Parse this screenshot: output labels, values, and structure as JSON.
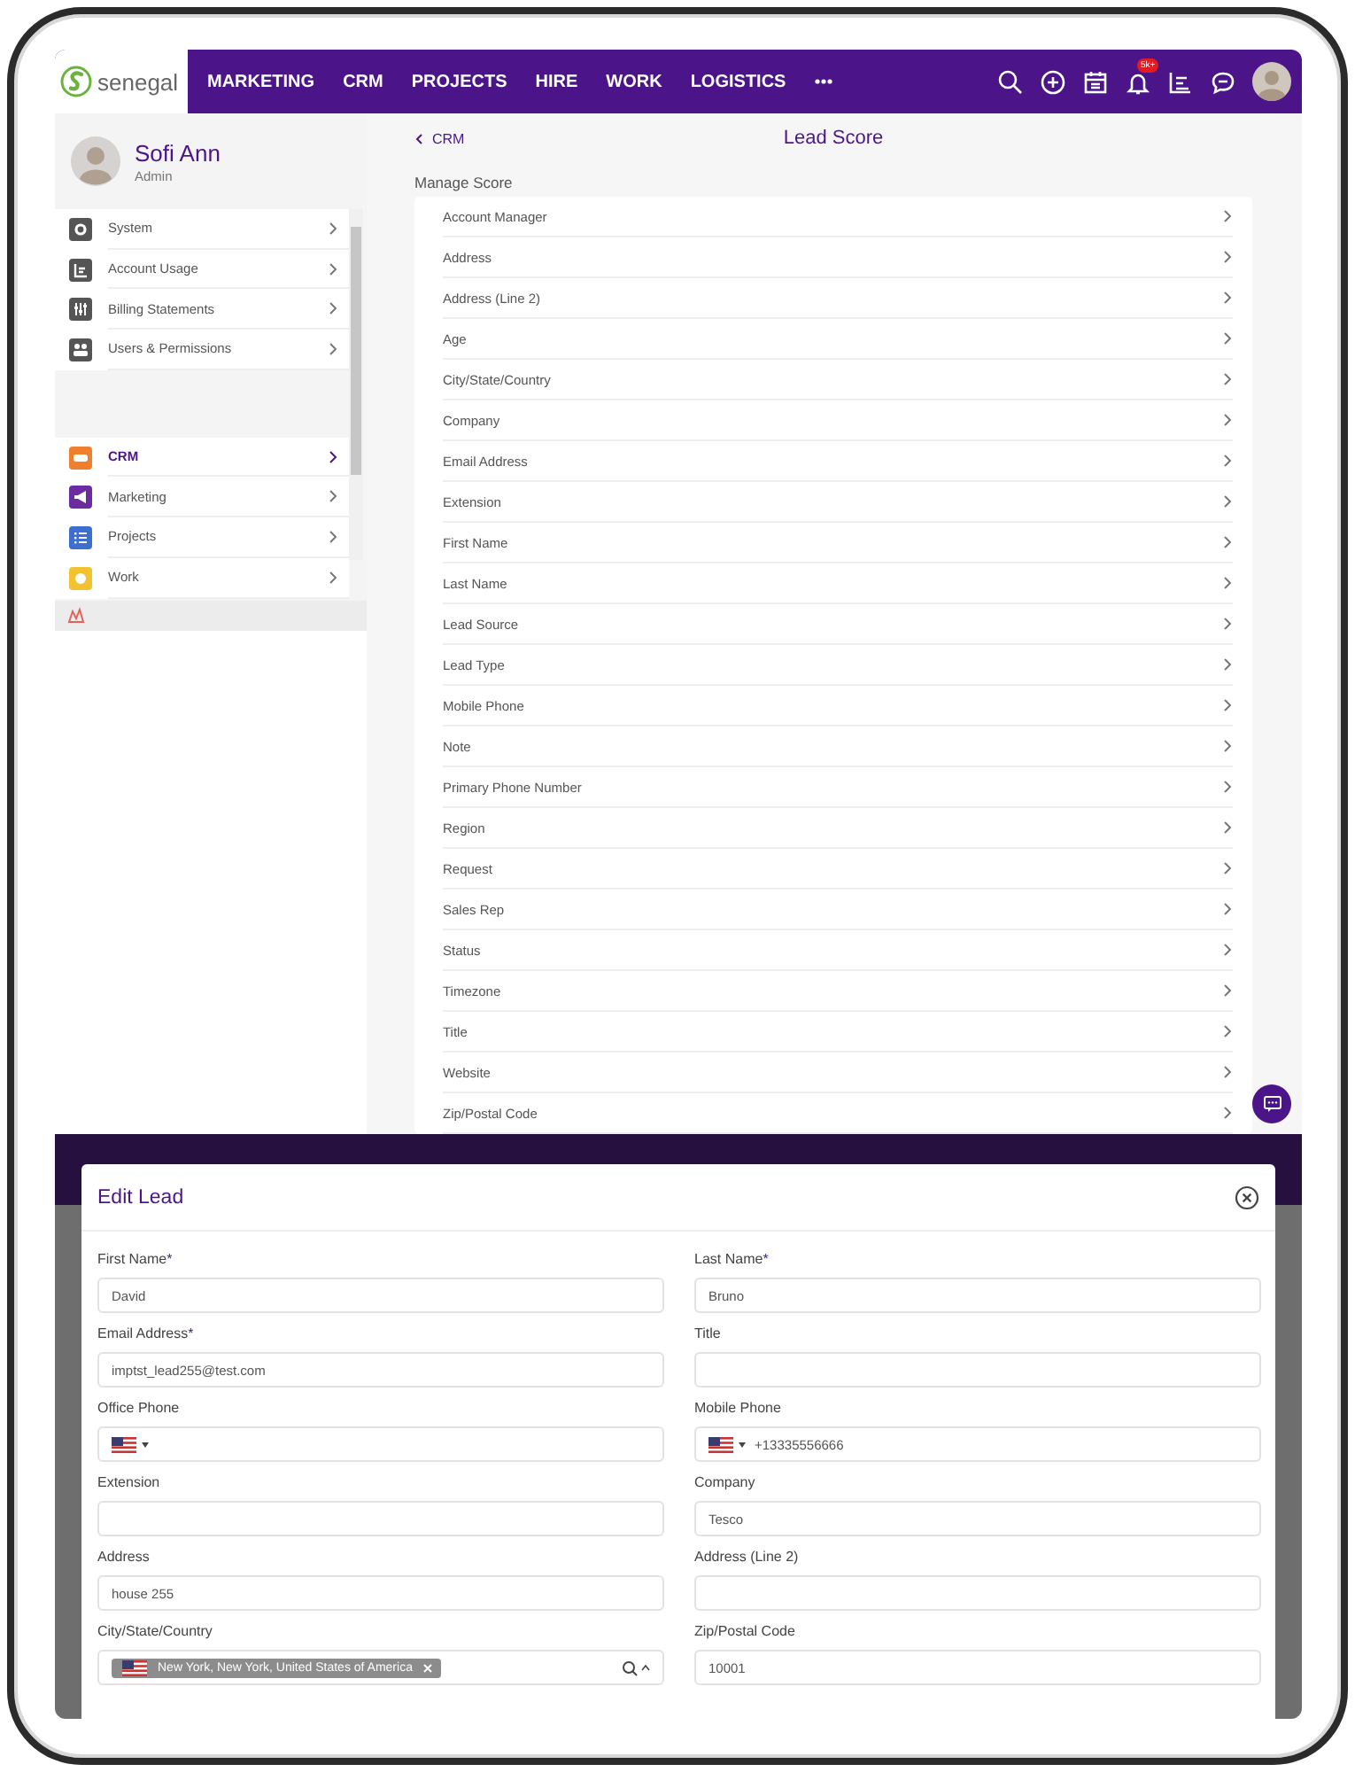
{
  "nav": {
    "brand": "senegal",
    "menu": [
      "MARKETING",
      "CRM",
      "PROJECTS",
      "HIRE",
      "WORK",
      "LOGISTICS"
    ],
    "badge": "5k+"
  },
  "profile": {
    "name": "Sofi Ann",
    "role": "Admin"
  },
  "sidebar": {
    "groups": [
      [
        {
          "label": "System",
          "color": "#555555",
          "selected": false
        },
        {
          "label": "Account Usage",
          "color": "#555555",
          "selected": false
        },
        {
          "label": "Billing Statements",
          "color": "#555555",
          "selected": false
        },
        {
          "label": "Users & Permissions",
          "color": "#555555",
          "selected": false
        }
      ],
      [
        {
          "label": "CRM",
          "color": "#f07f2d",
          "selected": true
        },
        {
          "label": "Marketing",
          "color": "#6a2c9f",
          "selected": false
        },
        {
          "label": "Projects",
          "color": "#3d6fd1",
          "selected": false
        },
        {
          "label": "Work",
          "color": "#f2c230",
          "selected": false
        }
      ]
    ]
  },
  "page": {
    "back": "CRM",
    "title": "Lead Score",
    "section": "Manage Score",
    "items": [
      "Account Manager",
      "Address",
      "Address (Line 2)",
      "Age",
      "City/State/Country",
      "Company",
      "Email Address",
      "Extension",
      "First Name",
      "Last Name",
      "Lead Source",
      "Lead Type",
      "Mobile Phone",
      "Note",
      "Primary Phone Number",
      "Region",
      "Request",
      "Sales Rep",
      "Status",
      "Timezone",
      "Title",
      "Website",
      "Zip/Postal Code"
    ]
  },
  "modal": {
    "title": "Edit Lead",
    "fields": [
      {
        "label": "First Name",
        "mark": "*",
        "kind": "text",
        "value": "David"
      },
      {
        "label": "Last Name",
        "mark": "*",
        "kind": "text",
        "value": "Bruno"
      },
      {
        "label": "Email Address",
        "mark": "*",
        "kind": "text",
        "value": "imptst_lead255@test.com"
      },
      {
        "label": "Title",
        "kind": "text"
      },
      {
        "label": "Office Phone",
        "kind": "phone"
      },
      {
        "label": "Mobile Phone",
        "kind": "phone",
        "value": "+13335556666"
      },
      {
        "label": "Extension",
        "kind": "text"
      },
      {
        "label": "Company",
        "kind": "text",
        "value": "Tesco"
      },
      {
        "label": "Address",
        "kind": "text",
        "value": "house 255"
      },
      {
        "label": "Address (Line 2)",
        "kind": "text"
      },
      {
        "label": "City/State/Country",
        "kind": "location",
        "value": "New York, New York, United States of America"
      },
      {
        "label": "Zip/Postal Code",
        "kind": "text",
        "value": "10001"
      }
    ]
  }
}
